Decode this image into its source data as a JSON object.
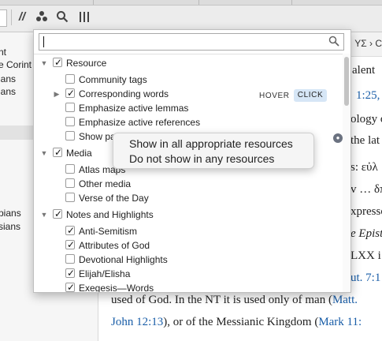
{
  "toolbar": {
    "icons": [
      "parallel-passages-icon",
      "people-icon",
      "search-icon",
      "columns-icon"
    ],
    "parallel_glyph": "//",
    "people_glyph": "☘",
    "search_glyph": "⌕",
    "columns_glyph": "|||"
  },
  "left_pane": {
    "lines": [
      "nt",
      "e Corint",
      "ians",
      "ians",
      "pians",
      "sians"
    ]
  },
  "right_pane": {
    "header_text": "ΥΣ › C",
    "lines": [
      {
        "pre": "alent ",
        "link": "",
        "post": ""
      },
      {
        "pre": "",
        "link": "1:25,",
        "post": ""
      },
      {
        "pre": "ology of",
        "link": "",
        "post": ""
      },
      {
        "pre": "the lat",
        "link": "",
        "post": ""
      },
      {
        "pre": "s: εὐλ",
        "link": "",
        "post": ""
      },
      {
        "pre": "v … δπ",
        "link": "",
        "post": ""
      },
      {
        "pre": "xpresse",
        "link": "",
        "post": ""
      },
      {
        "pre": "e Epistl",
        "link": "",
        "post": ""
      },
      {
        "pre": "LXX i",
        "link": "",
        "post": ""
      },
      {
        "pre": "",
        "link": "ut. 7:1",
        "post": ""
      }
    ],
    "line_used": "used of God. In the NT it is used only of man (",
    "line_used_link": "Matt.",
    "line_john_link": "John 12:13",
    "line_john_mid": "), or of the Messianic Kingdom (",
    "line_john_link2": "Mark 11:"
  },
  "dropdown": {
    "search_value": "",
    "search_placeholder": "",
    "hover_label": "HOVER",
    "click_label": "CLICK",
    "items": {
      "resource": "Resource",
      "community_tags": "Community tags",
      "corresponding_words": "Corresponding words",
      "emphasize_lemmas": "Emphasize active lemmas",
      "emphasize_references": "Emphasize active references",
      "show_pa": "Show pa",
      "media": "Media",
      "atlas_maps": "Atlas maps",
      "other_media": "Other media",
      "verse_of_day": "Verse of the Day",
      "notes_highlights": "Notes and Highlights",
      "anti_semitism": "Anti-Semitism",
      "attributes_god": "Attributes of God",
      "devotional": "Devotional Highlights",
      "elijah": "Elijah/Elisha",
      "exegesis": "Exegesis—Words"
    }
  },
  "popover": {
    "option_all": "Show in all appropriate resources",
    "option_none": "Do not show in any resources"
  }
}
